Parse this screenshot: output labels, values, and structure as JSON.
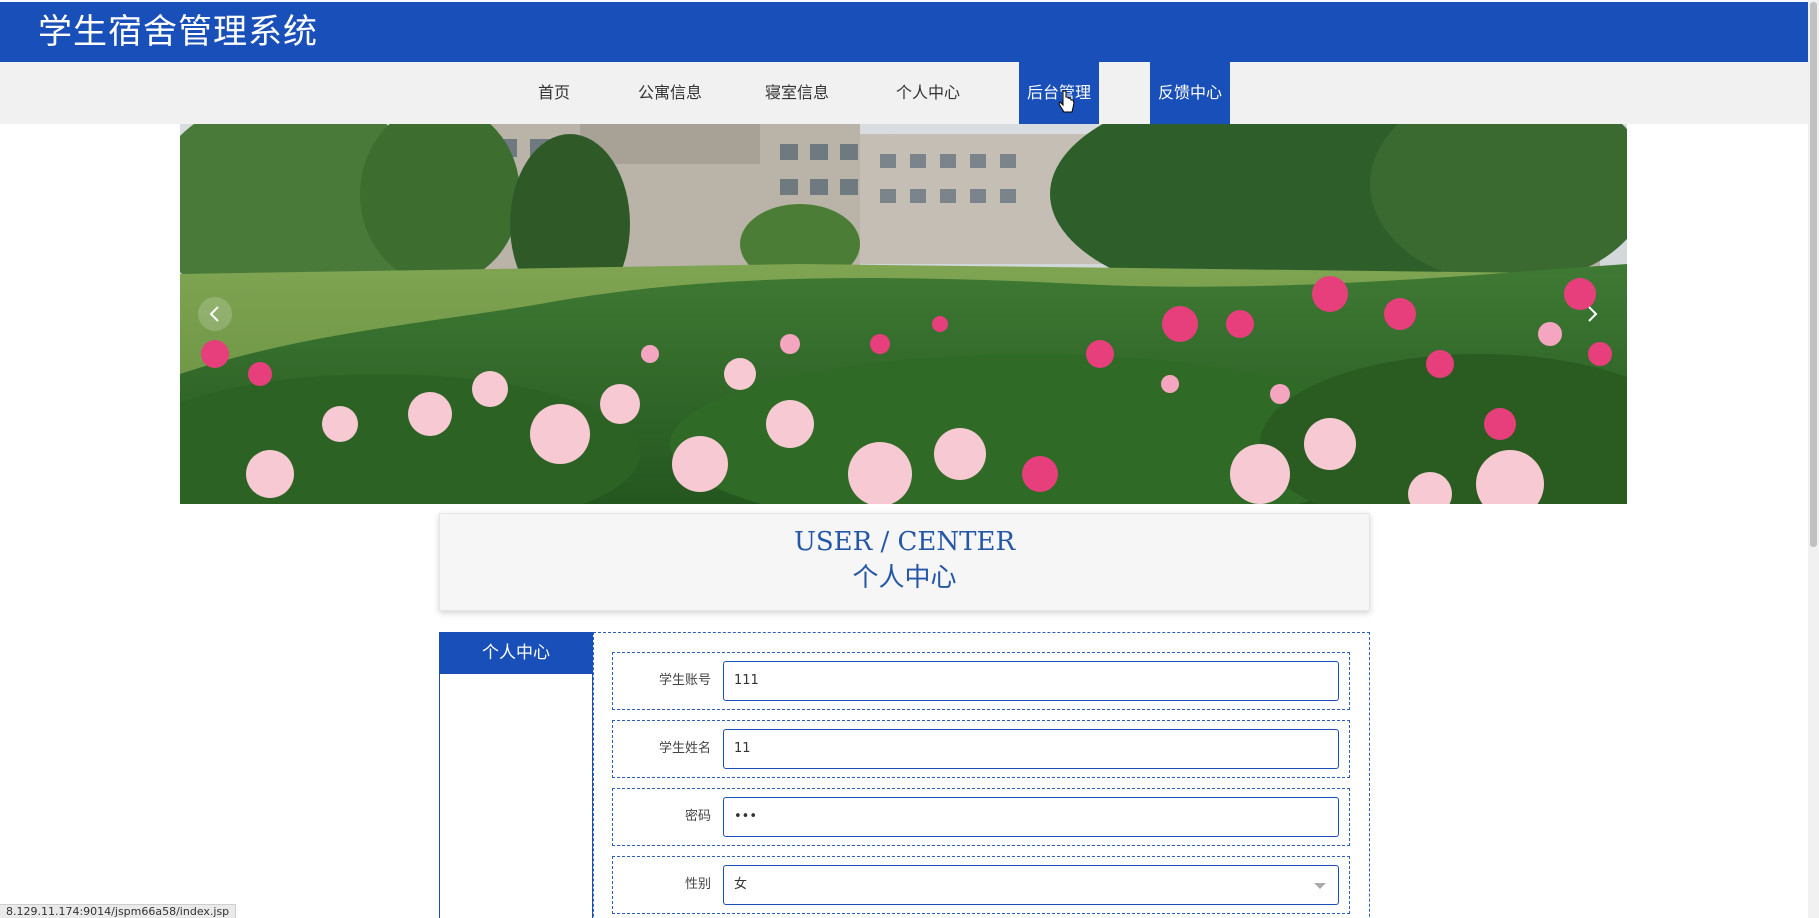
{
  "header": {
    "title": "学生宿舍管理系统"
  },
  "nav": {
    "items": [
      {
        "label": "首页"
      },
      {
        "label": "公寓信息"
      },
      {
        "label": "寝室信息"
      },
      {
        "label": "个人中心"
      },
      {
        "label": "后台管理",
        "active": true
      },
      {
        "label": "反馈中心",
        "active": true
      }
    ]
  },
  "banner": {
    "prev_icon": "chevron-left-icon",
    "next_icon": "chevron-right-icon"
  },
  "title_card": {
    "en": "USER / CENTER",
    "cn": "个人中心"
  },
  "sidebar": {
    "title": "个人中心"
  },
  "form": {
    "fields": [
      {
        "label": "学生账号",
        "value": "111"
      },
      {
        "label": "学生姓名",
        "value": "11"
      },
      {
        "label": "密码",
        "value": "•••"
      },
      {
        "label": "性别",
        "value": "女"
      }
    ]
  },
  "status_url": "8.129.11.174:9014/jspm66a58/index.jsp",
  "colors": {
    "brand": "#194fb8",
    "nav_bg": "#f1f1f1",
    "title_text": "#2557a8"
  }
}
